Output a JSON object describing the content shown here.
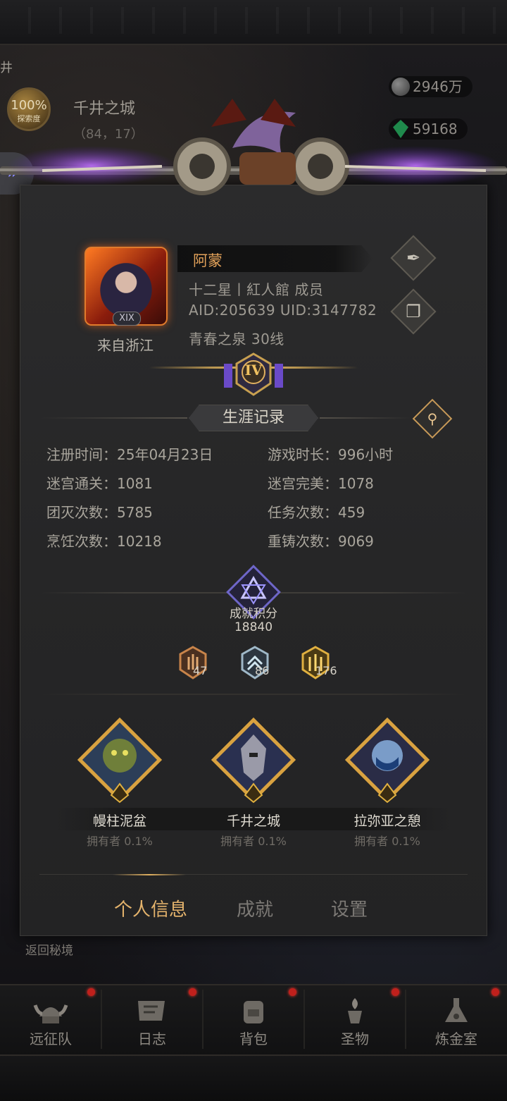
{
  "hud": {
    "explore_percent": "100%",
    "explore_label": "探索度",
    "location_name": "千井之城",
    "location_coords": "（84，17）",
    "silver": "2946万",
    "gems": "59168",
    "edge_glyph": "井",
    "return_label": "返回秘境"
  },
  "profile": {
    "name": "阿蒙",
    "title_line": "十二星丨紅人館  成员",
    "id_line": "AID:205639 UID:3147782",
    "server_line": "青春之泉  30线",
    "origin": "来自浙江",
    "avatar_level": "XIX",
    "rank_numeral": "IV"
  },
  "career": {
    "header": "生涯记录",
    "stats_left": [
      {
        "label": "注册时间：",
        "value": "25年04月23日"
      },
      {
        "label": "迷宫通关：",
        "value": "1081"
      },
      {
        "label": "团灭次数：",
        "value": "5785"
      },
      {
        "label": "烹饪次数：",
        "value": "10218"
      }
    ],
    "stats_right": [
      {
        "label": "游戏时长：",
        "value": "996小时"
      },
      {
        "label": "迷宫完美：",
        "value": "1078"
      },
      {
        "label": "任务次数：",
        "value": "459"
      },
      {
        "label": "重铸次数：",
        "value": "9069"
      }
    ]
  },
  "achievements": {
    "label": "成就积分",
    "score": "18840",
    "medals": [
      {
        "tier": "bronze",
        "count": "47",
        "color": "#c8844a"
      },
      {
        "tier": "silver",
        "count": "86",
        "color": "#9fb8c8"
      },
      {
        "tier": "gold",
        "count": "176",
        "color": "#e0b040"
      }
    ],
    "trophies": [
      {
        "name": "幔柱泥盆",
        "owner": "拥有者  0.1%"
      },
      {
        "name": "千井之城",
        "owner": "拥有者  0.1%"
      },
      {
        "name": "拉弥亚之憩",
        "owner": "拥有者  0.1%"
      }
    ]
  },
  "tabs": [
    {
      "label": "个人信息",
      "active": true
    },
    {
      "label": "成就",
      "active": false
    },
    {
      "label": "设置",
      "active": false
    }
  ],
  "bottom_nav": [
    {
      "label": "远征队",
      "icon": "viking-helmet-icon"
    },
    {
      "label": "日志",
      "icon": "journal-icon"
    },
    {
      "label": "背包",
      "icon": "backpack-icon"
    },
    {
      "label": "圣物",
      "icon": "relic-icon"
    },
    {
      "label": "炼金室",
      "icon": "alchemy-icon"
    }
  ],
  "colors": {
    "accent_gold": "#e4b36c",
    "name_orange": "#e3a25a",
    "panel_bg": "#2b2b2c",
    "notification_red": "#c0201c"
  }
}
